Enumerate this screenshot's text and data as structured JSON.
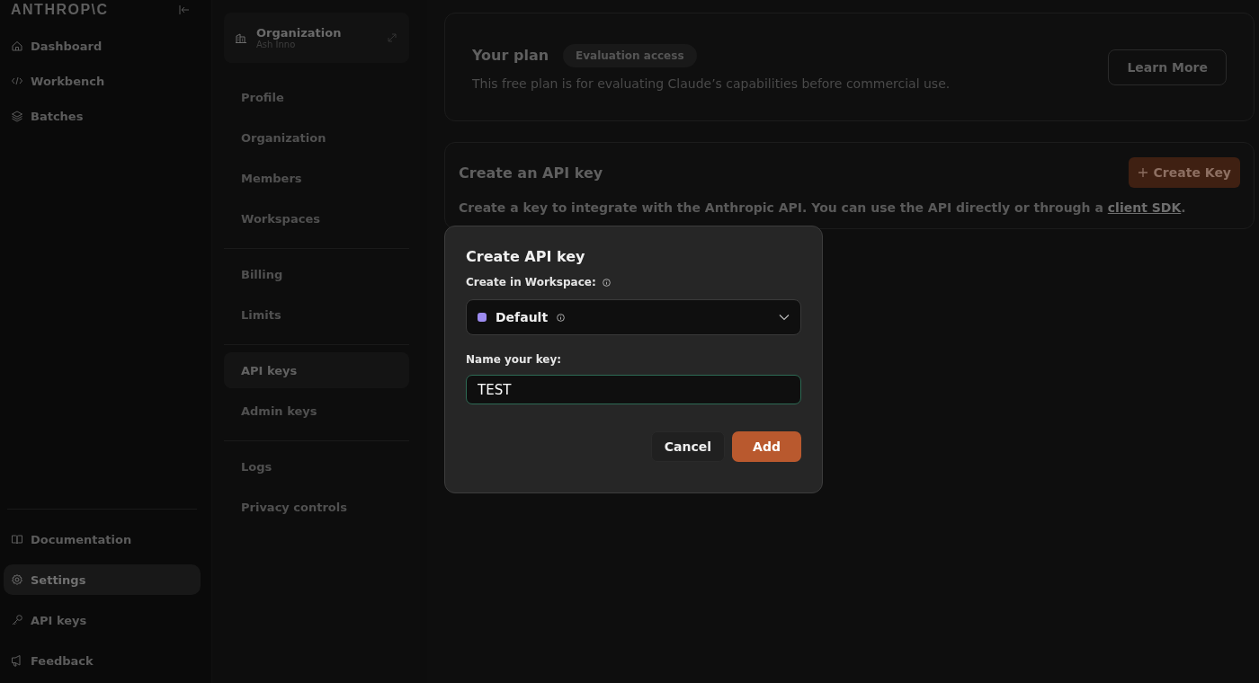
{
  "sidebar": {
    "logo": "ANTHROP\\C",
    "items": [
      {
        "label": "Dashboard",
        "kind": "home",
        "selected": false
      },
      {
        "label": "Workbench",
        "kind": "code",
        "selected": false
      },
      {
        "label": "Batches",
        "kind": "layers",
        "selected": false
      }
    ],
    "bottom_items": [
      {
        "label": "Documentation",
        "kind": "book",
        "selected": false
      },
      {
        "label": "Settings",
        "kind": "gear",
        "selected": true
      },
      {
        "label": "API keys",
        "kind": "key",
        "selected": false
      },
      {
        "label": "Feedback",
        "kind": "megaphone",
        "selected": false
      }
    ]
  },
  "settings_nav": {
    "org_card": {
      "title": "Organization",
      "subtitle": "Ash Inno"
    },
    "groups": [
      [
        {
          "label": "Profile",
          "selected": false
        },
        {
          "label": "Organization",
          "selected": false
        },
        {
          "label": "Members",
          "selected": false
        },
        {
          "label": "Workspaces",
          "selected": false
        }
      ],
      [
        {
          "label": "Billing",
          "selected": false
        },
        {
          "label": "Limits",
          "selected": false
        }
      ],
      [
        {
          "label": "API keys",
          "selected": true
        },
        {
          "label": "Admin keys",
          "selected": false
        }
      ],
      [
        {
          "label": "Logs",
          "selected": false
        },
        {
          "label": "Privacy controls",
          "selected": false
        }
      ]
    ]
  },
  "plan_card": {
    "title": "Your plan",
    "badge": "Evaluation access",
    "description": "This free plan is for evaluating Claude’s capabilities before commercial use.",
    "button": "Learn More"
  },
  "api_key_card": {
    "title": "Create an API key",
    "button": "Create Key",
    "description": "Create a key to integrate with the Anthropic API. You can use the API directly or through a ",
    "link": "client SDK",
    "description_end": "."
  },
  "modal": {
    "title": "Create API key",
    "workspace_label": "Create in Workspace:",
    "workspace": {
      "name": "Default",
      "color": "#9d8cf0"
    },
    "name_label": "Name your key:",
    "name_value": "TEST",
    "buttons": {
      "cancel": "Cancel",
      "add": "Add"
    }
  }
}
